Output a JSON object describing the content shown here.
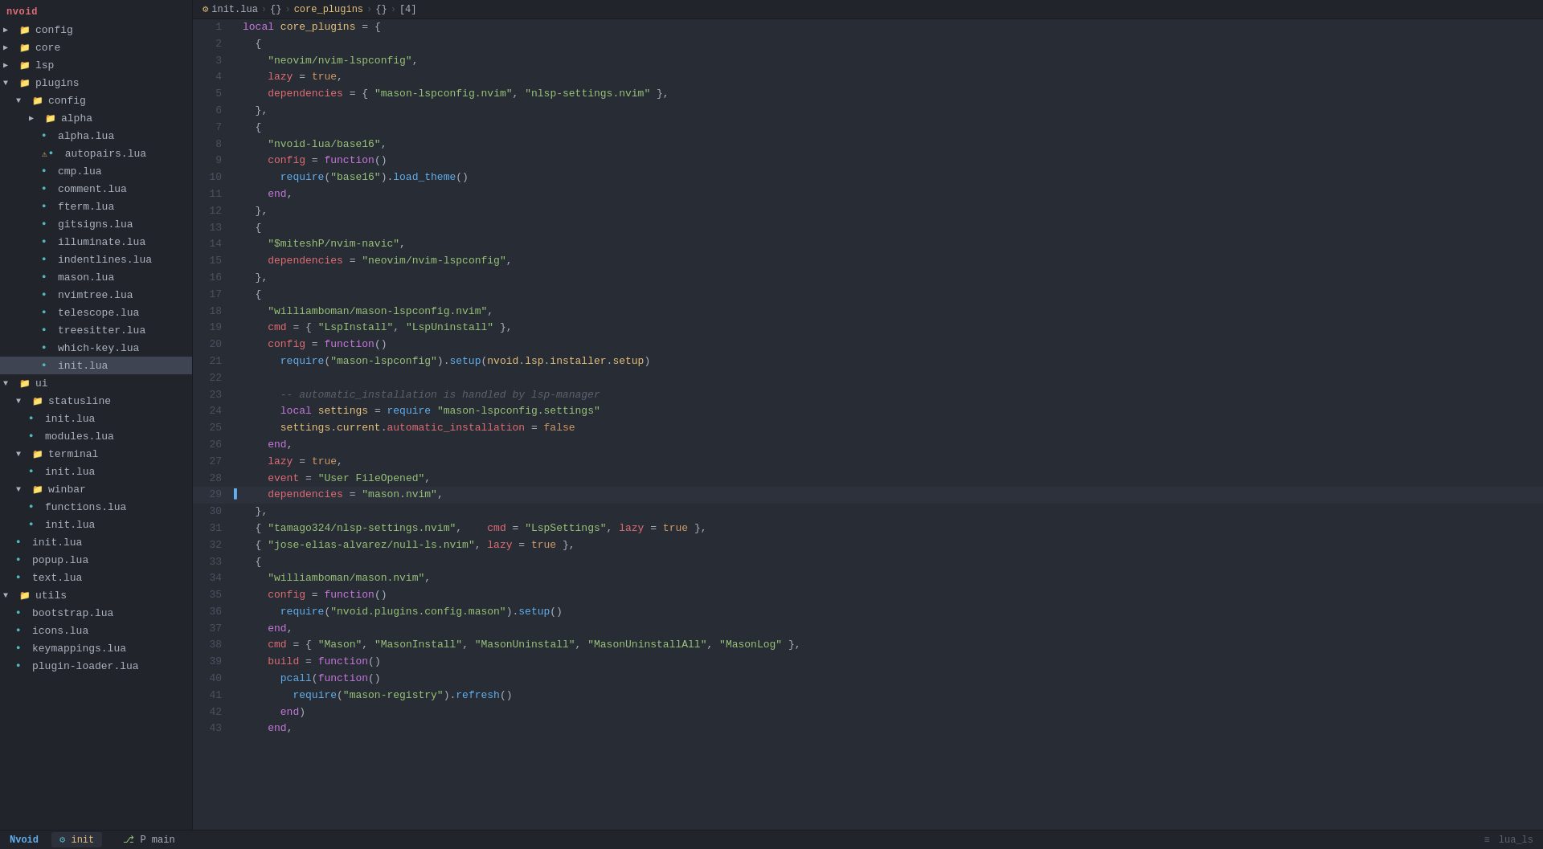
{
  "sidebar": {
    "title": "nvoid",
    "items": [
      {
        "id": "config",
        "label": "config",
        "type": "folder",
        "depth": 0,
        "expanded": true,
        "chevron": "▶"
      },
      {
        "id": "core",
        "label": "core",
        "type": "folder",
        "depth": 0,
        "expanded": false,
        "chevron": "▶"
      },
      {
        "id": "lsp",
        "label": "lsp",
        "type": "folder",
        "depth": 0,
        "expanded": false,
        "chevron": "▶"
      },
      {
        "id": "plugins",
        "label": "plugins",
        "type": "folder",
        "depth": 0,
        "expanded": true,
        "chevron": "▼"
      },
      {
        "id": "plugins-config",
        "label": "config",
        "type": "folder",
        "depth": 1,
        "expanded": true,
        "chevron": "▼"
      },
      {
        "id": "alpha",
        "label": "alpha",
        "type": "folder",
        "depth": 2,
        "expanded": false,
        "chevron": "▶"
      },
      {
        "id": "alpha-lua",
        "label": "alpha.lua",
        "type": "file",
        "depth": 3,
        "warning": false
      },
      {
        "id": "autopairs-lua",
        "label": "autopairs.lua",
        "type": "file",
        "depth": 3,
        "warning": true
      },
      {
        "id": "cmp-lua",
        "label": "cmp.lua",
        "type": "file",
        "depth": 3,
        "warning": false
      },
      {
        "id": "comment-lua",
        "label": "comment.lua",
        "type": "file",
        "depth": 3,
        "warning": false
      },
      {
        "id": "fterm-lua",
        "label": "fterm.lua",
        "type": "file",
        "depth": 3,
        "warning": false
      },
      {
        "id": "gitsigns-lua",
        "label": "gitsigns.lua",
        "type": "file",
        "depth": 3,
        "warning": false
      },
      {
        "id": "illuminate-lua",
        "label": "illuminate.lua",
        "type": "file",
        "depth": 3,
        "warning": false
      },
      {
        "id": "indentlines-lua",
        "label": "indentlines.lua",
        "type": "file",
        "depth": 3,
        "warning": false
      },
      {
        "id": "mason-lua",
        "label": "mason.lua",
        "type": "file",
        "depth": 3,
        "warning": false
      },
      {
        "id": "nvimtree-lua",
        "label": "nvimtree.lua",
        "type": "file",
        "depth": 3,
        "warning": false
      },
      {
        "id": "telescope-lua",
        "label": "telescope.lua",
        "type": "file",
        "depth": 3,
        "warning": false
      },
      {
        "id": "treesitter-lua",
        "label": "treesitter.lua",
        "type": "file",
        "depth": 3,
        "warning": false
      },
      {
        "id": "which-key-lua",
        "label": "which-key.lua",
        "type": "file",
        "depth": 3,
        "warning": false
      },
      {
        "id": "init-lua",
        "label": "init.lua",
        "type": "file",
        "depth": 3,
        "active": true,
        "warning": false
      },
      {
        "id": "ui",
        "label": "ui",
        "type": "folder",
        "depth": 0,
        "expanded": true,
        "chevron": "▼"
      },
      {
        "id": "statusline",
        "label": "statusline",
        "type": "folder",
        "depth": 1,
        "expanded": true,
        "chevron": "▼"
      },
      {
        "id": "statusline-init",
        "label": "init.lua",
        "type": "file",
        "depth": 2,
        "warning": false
      },
      {
        "id": "statusline-modules",
        "label": "modules.lua",
        "type": "file",
        "depth": 2,
        "warning": false
      },
      {
        "id": "terminal",
        "label": "terminal",
        "type": "folder",
        "depth": 1,
        "expanded": true,
        "chevron": "▼"
      },
      {
        "id": "terminal-init",
        "label": "init.lua",
        "type": "file",
        "depth": 2,
        "warning": false
      },
      {
        "id": "winbar",
        "label": "winbar",
        "type": "folder",
        "depth": 1,
        "expanded": true,
        "chevron": "▼"
      },
      {
        "id": "winbar-functions",
        "label": "functions.lua",
        "type": "file",
        "depth": 2,
        "warning": false
      },
      {
        "id": "winbar-init",
        "label": "init.lua",
        "type": "file",
        "depth": 2,
        "warning": false
      },
      {
        "id": "init-lua-root",
        "label": "init.lua",
        "type": "file",
        "depth": 1,
        "warning": false
      },
      {
        "id": "popup-lua",
        "label": "popup.lua",
        "type": "file",
        "depth": 1,
        "warning": false
      },
      {
        "id": "text-lua",
        "label": "text.lua",
        "type": "file",
        "depth": 1,
        "warning": false
      },
      {
        "id": "utils",
        "label": "utils",
        "type": "folder",
        "depth": 0,
        "expanded": true,
        "chevron": "▼"
      },
      {
        "id": "bootstrap-lua",
        "label": "bootstrap.lua",
        "type": "file",
        "depth": 1,
        "warning": false
      },
      {
        "id": "icons-lua",
        "label": "icons.lua",
        "type": "file",
        "depth": 1,
        "warning": false
      },
      {
        "id": "keymappings-lua",
        "label": "keymappings.lua",
        "type": "file",
        "depth": 1,
        "warning": false
      },
      {
        "id": "plugin-loader-lua",
        "label": "plugin-loader.lua",
        "type": "file",
        "depth": 1,
        "warning": false
      }
    ]
  },
  "breadcrumb": {
    "icon": "⚙",
    "filename": "init.lua",
    "path": [
      {
        "label": "{}"
      },
      {
        "label": "core_plugins"
      },
      {
        "label": ">"
      },
      {
        "label": "{}"
      },
      {
        "label": "[4]"
      }
    ]
  },
  "editor": {
    "lines": [
      {
        "num": 1,
        "indicator": "",
        "content": "local core_plugins = {"
      },
      {
        "num": 2,
        "indicator": "",
        "content": "  {"
      },
      {
        "num": 3,
        "indicator": "",
        "content": "    \"neovim/nvim-lspconfig\","
      },
      {
        "num": 4,
        "indicator": "",
        "content": "    lazy = true,"
      },
      {
        "num": 5,
        "indicator": "",
        "content": "    dependencies = { \"mason-lspconfig.nvim\", \"nlsp-settings.nvim\" },"
      },
      {
        "num": 6,
        "indicator": "",
        "content": "  },"
      },
      {
        "num": 7,
        "indicator": "",
        "content": "  {"
      },
      {
        "num": 8,
        "indicator": "",
        "content": "    \"nvoid-lua/base16\","
      },
      {
        "num": 9,
        "indicator": "",
        "content": "    config = function()"
      },
      {
        "num": 10,
        "indicator": "",
        "content": "      require(\"base16\").load_theme()"
      },
      {
        "num": 11,
        "indicator": "",
        "content": "    end,"
      },
      {
        "num": 12,
        "indicator": "",
        "content": "  },"
      },
      {
        "num": 13,
        "indicator": "",
        "content": "  {"
      },
      {
        "num": 14,
        "indicator": "",
        "content": "    \"$miteshP/nvim-navic\","
      },
      {
        "num": 15,
        "indicator": "",
        "content": "    dependencies = \"neovim/nvim-lspconfig\","
      },
      {
        "num": 16,
        "indicator": "",
        "content": "  },"
      },
      {
        "num": 17,
        "indicator": "",
        "content": "  {"
      },
      {
        "num": 18,
        "indicator": "",
        "content": "    \"williamboman/mason-lspconfig.nvim\","
      },
      {
        "num": 19,
        "indicator": "",
        "content": "    cmd = { \"LspInstall\", \"LspUninstall\" },"
      },
      {
        "num": 20,
        "indicator": "",
        "content": "    config = function()"
      },
      {
        "num": 21,
        "indicator": "",
        "content": "      require(\"mason-lspconfig\").setup(nvoid.lsp.installer.setup)"
      },
      {
        "num": 22,
        "indicator": "",
        "content": ""
      },
      {
        "num": 23,
        "indicator": "",
        "content": "      -- automatic_installation is handled by lsp-manager"
      },
      {
        "num": 24,
        "indicator": "",
        "content": "      local settings = require \"mason-lspconfig.settings\""
      },
      {
        "num": 25,
        "indicator": "",
        "content": "      settings.current.automatic_installation = false"
      },
      {
        "num": 26,
        "indicator": "",
        "content": "    end,"
      },
      {
        "num": 27,
        "indicator": "",
        "content": "    lazy = true,"
      },
      {
        "num": 28,
        "indicator": "",
        "content": "    event = \"User FileOpened\","
      },
      {
        "num": 29,
        "indicator": "▌",
        "content": "    dependencies = \"mason.nvim\",",
        "active": true
      },
      {
        "num": 30,
        "indicator": "",
        "content": "  },"
      },
      {
        "num": 31,
        "indicator": "",
        "content": "  { \"tamago324/nlsp-settings.nvim\",    cmd = \"LspSettings\", lazy = true },"
      },
      {
        "num": 32,
        "indicator": "",
        "content": "  { \"jose-elias-alvarez/null-ls.nvim\", lazy = true },"
      },
      {
        "num": 33,
        "indicator": "",
        "content": "  {"
      },
      {
        "num": 34,
        "indicator": "",
        "content": "    \"williamboman/mason.nvim\","
      },
      {
        "num": 35,
        "indicator": "",
        "content": "    config = function()"
      },
      {
        "num": 36,
        "indicator": "",
        "content": "      require(\"nvoid.plugins.config.mason\").setup()"
      },
      {
        "num": 37,
        "indicator": "",
        "content": "    end,"
      },
      {
        "num": 38,
        "indicator": "",
        "content": "    cmd = { \"Mason\", \"MasonInstall\", \"MasonUninstall\", \"MasonUninstallAll\", \"MasonLog\" },"
      },
      {
        "num": 39,
        "indicator": "",
        "content": "    build = function()"
      },
      {
        "num": 40,
        "indicator": "",
        "content": "      pcall(function()"
      },
      {
        "num": 41,
        "indicator": "",
        "content": "        require(\"mason-registry\").refresh()"
      },
      {
        "num": 42,
        "indicator": "",
        "content": "      end)"
      },
      {
        "num": 43,
        "indicator": "",
        "content": "    end,"
      }
    ]
  },
  "statusbar": {
    "nvoid_label": "Nvoid",
    "init_label": " init",
    "main_label": "P main",
    "right_label": "lua_ls"
  }
}
